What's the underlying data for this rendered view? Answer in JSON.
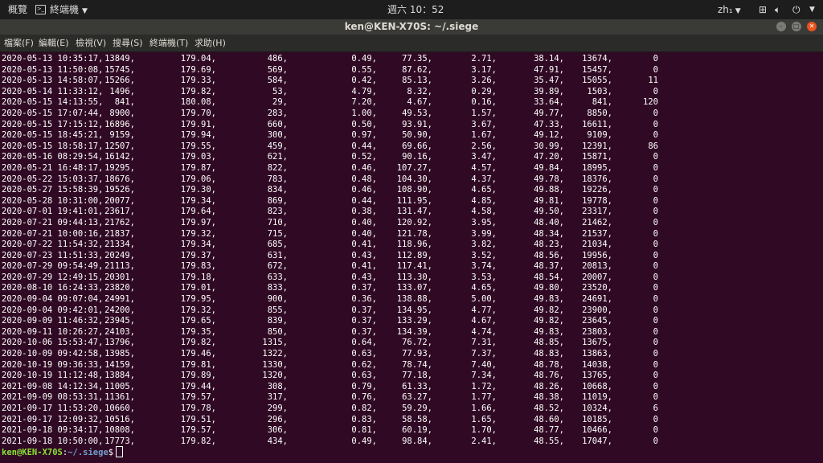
{
  "topbar": {
    "activities": "概覽",
    "app_name": "終端機",
    "clock": "週六 10：52",
    "lang": "zh₁",
    "icons": [
      "network-icon",
      "volume-icon",
      "power-icon",
      "menu-caret-icon"
    ]
  },
  "window": {
    "title": "ken@KEN-X70S: ~/.siege",
    "buttons": [
      "minimize",
      "maximize",
      "close"
    ]
  },
  "menubar": {
    "items": [
      "檔案(F)",
      "編輯(E)",
      "檢視(V)",
      "搜尋(S)",
      "終端機(T)",
      "求助(H)"
    ]
  },
  "terminal": {
    "rows": [
      [
        "2020-05-13 10:35:17,",
        "13849,",
        "179.04,",
        "486,",
        "0.49,",
        "77.35,",
        "2.71,",
        "38.14,",
        "13674,",
        "0"
      ],
      [
        "2020-05-13 11:50:08,",
        "15745,",
        "179.69,",
        "569,",
        "0.55,",
        "87.62,",
        "3.17,",
        "47.91,",
        "15457,",
        "0"
      ],
      [
        "2020-05-13 14:58:07,",
        "15266,",
        "179.33,",
        "584,",
        "0.42,",
        "85.13,",
        "3.26,",
        "35.47,",
        "15055,",
        "11"
      ],
      [
        "2020-05-14 11:33:12,",
        "1496,",
        "179.82,",
        "53,",
        "4.79,",
        "8.32,",
        "0.29,",
        "39.89,",
        "1503,",
        "0"
      ],
      [
        "2020-05-15 14:13:55,",
        "841,",
        "180.08,",
        "29,",
        "7.20,",
        "4.67,",
        "0.16,",
        "33.64,",
        "841,",
        "120"
      ],
      [
        "2020-05-15 17:07:44,",
        "8900,",
        "179.70,",
        "283,",
        "1.00,",
        "49.53,",
        "1.57,",
        "49.77,",
        "8850,",
        "0"
      ],
      [
        "2020-05-15 17:15:12,",
        "16896,",
        "179.91,",
        "660,",
        "0.50,",
        "93.91,",
        "3.67,",
        "47.33,",
        "16611,",
        "0"
      ],
      [
        "2020-05-15 18:45:21,",
        "9159,",
        "179.94,",
        "300,",
        "0.97,",
        "50.90,",
        "1.67,",
        "49.12,",
        "9109,",
        "0"
      ],
      [
        "2020-05-15 18:58:17,",
        "12507,",
        "179.55,",
        "459,",
        "0.44,",
        "69.66,",
        "2.56,",
        "30.99,",
        "12391,",
        "86"
      ],
      [
        "2020-05-16 08:29:54,",
        "16142,",
        "179.03,",
        "621,",
        "0.52,",
        "90.16,",
        "3.47,",
        "47.20,",
        "15871,",
        "0"
      ],
      [
        "2020-05-21 16:48:17,",
        "19295,",
        "179.87,",
        "822,",
        "0.46,",
        "107.27,",
        "4.57,",
        "49.84,",
        "18995,",
        "0"
      ],
      [
        "2020-05-22 15:03:37,",
        "18676,",
        "179.06,",
        "783,",
        "0.48,",
        "104.30,",
        "4.37,",
        "49.78,",
        "18376,",
        "0"
      ],
      [
        "2020-05-27 15:58:39,",
        "19526,",
        "179.30,",
        "834,",
        "0.46,",
        "108.90,",
        "4.65,",
        "49.88,",
        "19226,",
        "0"
      ],
      [
        "2020-05-28 10:31:00,",
        "20077,",
        "179.34,",
        "869,",
        "0.44,",
        "111.95,",
        "4.85,",
        "49.81,",
        "19778,",
        "0"
      ],
      [
        "2020-07-01 19:41:01,",
        "23617,",
        "179.64,",
        "823,",
        "0.38,",
        "131.47,",
        "4.58,",
        "49.50,",
        "23317,",
        "0"
      ],
      [
        "2020-07-21 09:44:13,",
        "21762,",
        "179.97,",
        "710,",
        "0.40,",
        "120.92,",
        "3.95,",
        "48.40,",
        "21462,",
        "0"
      ],
      [
        "2020-07-21 10:00:16,",
        "21837,",
        "179.32,",
        "715,",
        "0.40,",
        "121.78,",
        "3.99,",
        "48.34,",
        "21537,",
        "0"
      ],
      [
        "2020-07-22 11:54:32,",
        "21334,",
        "179.34,",
        "685,",
        "0.41,",
        "118.96,",
        "3.82,",
        "48.23,",
        "21034,",
        "0"
      ],
      [
        "2020-07-23 11:51:33,",
        "20249,",
        "179.37,",
        "631,",
        "0.43,",
        "112.89,",
        "3.52,",
        "48.56,",
        "19956,",
        "0"
      ],
      [
        "2020-07-29 09:54:49,",
        "21113,",
        "179.83,",
        "672,",
        "0.41,",
        "117.41,",
        "3.74,",
        "48.37,",
        "20813,",
        "0"
      ],
      [
        "2020-07-29 12:49:15,",
        "20301,",
        "179.18,",
        "633,",
        "0.43,",
        "113.30,",
        "3.53,",
        "48.54,",
        "20007,",
        "0"
      ],
      [
        "2020-08-10 16:24:33,",
        "23820,",
        "179.01,",
        "833,",
        "0.37,",
        "133.07,",
        "4.65,",
        "49.80,",
        "23520,",
        "0"
      ],
      [
        "2020-09-04 09:07:04,",
        "24991,",
        "179.95,",
        "900,",
        "0.36,",
        "138.88,",
        "5.00,",
        "49.83,",
        "24691,",
        "0"
      ],
      [
        "2020-09-04 09:42:01,",
        "24200,",
        "179.32,",
        "855,",
        "0.37,",
        "134.95,",
        "4.77,",
        "49.82,",
        "23900,",
        "0"
      ],
      [
        "2020-09-09 11:46:32,",
        "23945,",
        "179.65,",
        "839,",
        "0.37,",
        "133.29,",
        "4.67,",
        "49.82,",
        "23645,",
        "0"
      ],
      [
        "2020-09-11 10:26:27,",
        "24103,",
        "179.35,",
        "850,",
        "0.37,",
        "134.39,",
        "4.74,",
        "49.83,",
        "23803,",
        "0"
      ],
      [
        "2020-10-06 15:53:47,",
        "13796,",
        "179.82,",
        "1315,",
        "0.64,",
        "76.72,",
        "7.31,",
        "48.85,",
        "13675,",
        "0"
      ],
      [
        "2020-10-09 09:42:58,",
        "13985,",
        "179.46,",
        "1322,",
        "0.63,",
        "77.93,",
        "7.37,",
        "48.83,",
        "13863,",
        "0"
      ],
      [
        "2020-10-19 09:36:33,",
        "14159,",
        "179.81,",
        "1330,",
        "0.62,",
        "78.74,",
        "7.40,",
        "48.78,",
        "14038,",
        "0"
      ],
      [
        "2020-10-19 11:12:48,",
        "13884,",
        "179.89,",
        "1320,",
        "0.63,",
        "77.18,",
        "7.34,",
        "48.76,",
        "13765,",
        "0"
      ],
      [
        "2021-09-08 14:12:34,",
        "11005,",
        "179.44,",
        "308,",
        "0.79,",
        "61.33,",
        "1.72,",
        "48.26,",
        "10668,",
        "0"
      ],
      [
        "2021-09-09 08:53:31,",
        "11361,",
        "179.57,",
        "317,",
        "0.76,",
        "63.27,",
        "1.77,",
        "48.38,",
        "11019,",
        "0"
      ],
      [
        "2021-09-17 11:53:20,",
        "10660,",
        "179.78,",
        "299,",
        "0.82,",
        "59.29,",
        "1.66,",
        "48.52,",
        "10324,",
        "6"
      ],
      [
        "2021-09-17 12:09:32,",
        "10516,",
        "179.51,",
        "296,",
        "0.83,",
        "58.58,",
        "1.65,",
        "48.60,",
        "10185,",
        "0"
      ],
      [
        "2021-09-18 09:34:17,",
        "10808,",
        "179.57,",
        "306,",
        "0.81,",
        "60.19,",
        "1.70,",
        "48.77,",
        "10466,",
        "0"
      ],
      [
        "2021-09-18 10:50:00,",
        "17773,",
        "179.82,",
        "434,",
        "0.49,",
        "98.84,",
        "2.41,",
        "48.55,",
        "17047,",
        "0"
      ]
    ],
    "prompt": {
      "user_host": "ken@KEN-X70S",
      "colon": ":",
      "path": "~/.siege",
      "dollar": "$"
    }
  },
  "colors": {
    "terminal_bg": "#300a24",
    "prompt_user": "#8ae234",
    "prompt_path": "#729fcf",
    "close_button": "#e95420"
  }
}
